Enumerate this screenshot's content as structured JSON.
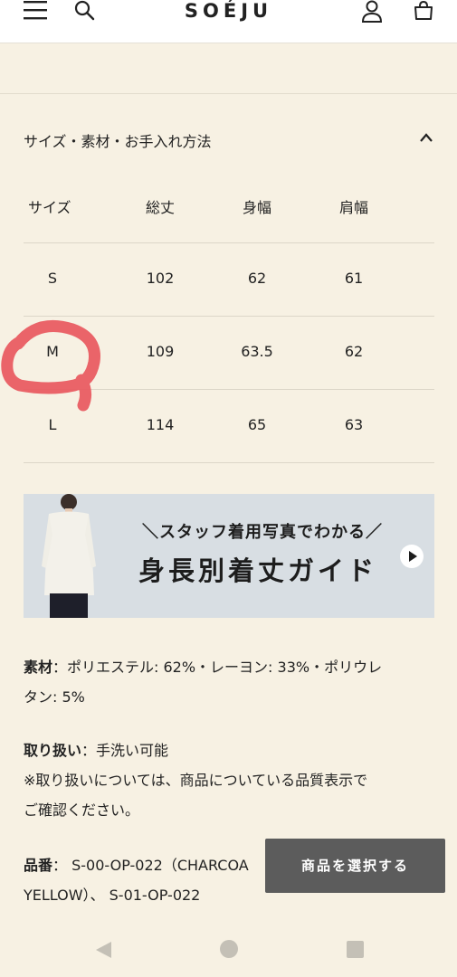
{
  "header": {
    "logo": "SOÉJU",
    "icons": [
      "menu-icon",
      "search-icon",
      "user-icon",
      "bag-icon"
    ]
  },
  "section": {
    "title": "サイズ・素材・お手入れ方法",
    "toggle_icon": "chevron-up-icon"
  },
  "size_table": {
    "headers": [
      "サイズ",
      "総丈",
      "身幅",
      "肩幅"
    ],
    "rows": [
      [
        "S",
        "102",
        "62",
        "61"
      ],
      [
        "M",
        "109",
        "63.5",
        "62"
      ],
      [
        "L",
        "114",
        "65",
        "63"
      ]
    ]
  },
  "annotation": {
    "color": "#e8585e",
    "marks": "M"
  },
  "banner": {
    "subtitle": "＼スタッフ着用写真でわかる／",
    "title": "身長別着丈ガイド",
    "play_icon": "play-icon"
  },
  "material": {
    "label": "素材",
    "line1": "：ポリエステル: 62%・レーヨン: 33%・ポリウレ",
    "line2": "タン: 5%"
  },
  "handling": {
    "label": "取り扱い",
    "line1": "：手洗い可能",
    "line2": "※取り扱いについては、商品についている品質表示で",
    "line3": "ご確認ください。"
  },
  "product_number": {
    "label": "品番",
    "line1": "： S-00-OP-022（CHARCOA",
    "line2": "YELLOW）、 S-01-OP-022"
  },
  "select_button": {
    "label": "商品を選択する"
  },
  "colors": {
    "background": "#f7f1e3",
    "header": "#ffffff",
    "button": "#5c5c5c",
    "banner": "#d8dee3"
  }
}
